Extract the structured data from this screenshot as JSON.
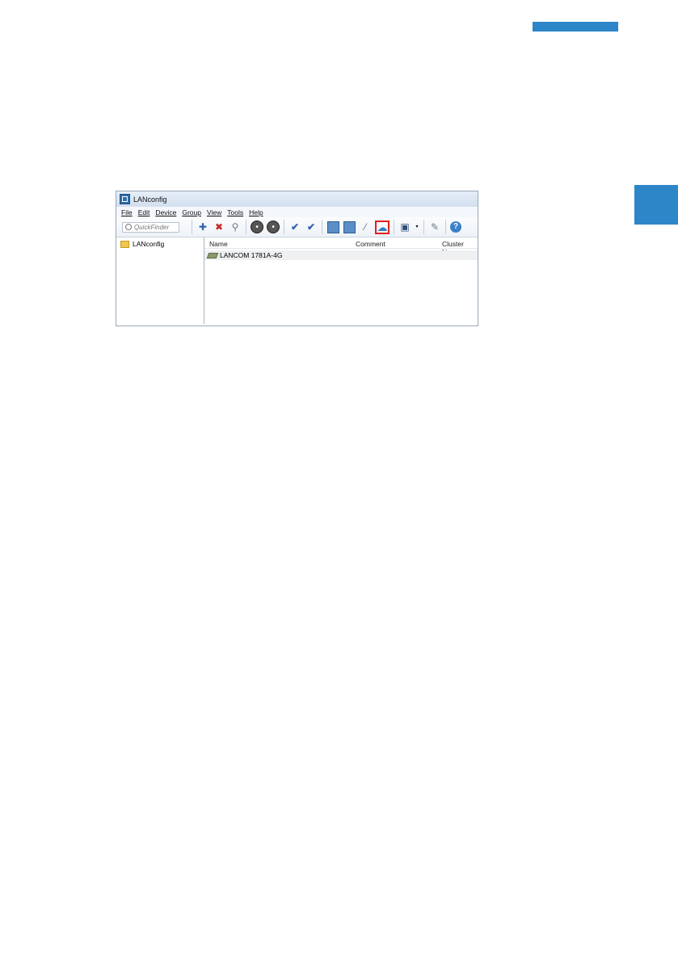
{
  "window": {
    "title": "LANconfig"
  },
  "menu": [
    "File",
    "Edit",
    "Device",
    "Group",
    "View",
    "Tools",
    "Help"
  ],
  "toolbar": {
    "quickfinder_placeholder": "QuickFinder",
    "icons": [
      "new-device-icon",
      "delete-device-icon",
      "search-device-icon",
      "stop-icon",
      "stop-all-icon",
      "check-icon",
      "check-all-icon",
      "configure-icon",
      "configure-all-icon",
      "wizard-icon",
      "cloud-icon",
      "save-icon",
      "tools-icon",
      "help-icon"
    ],
    "highlighted": "cloud-icon",
    "highlight_color": "#e02020"
  },
  "tree": {
    "items": [
      "LANconfig"
    ]
  },
  "list": {
    "columns": [
      "Name",
      "Comment",
      "Cluster Nam"
    ],
    "rows": [
      {
        "name": "LANCOM 1781A-4G"
      }
    ]
  },
  "colors": {
    "accent": "#2c86c8"
  }
}
